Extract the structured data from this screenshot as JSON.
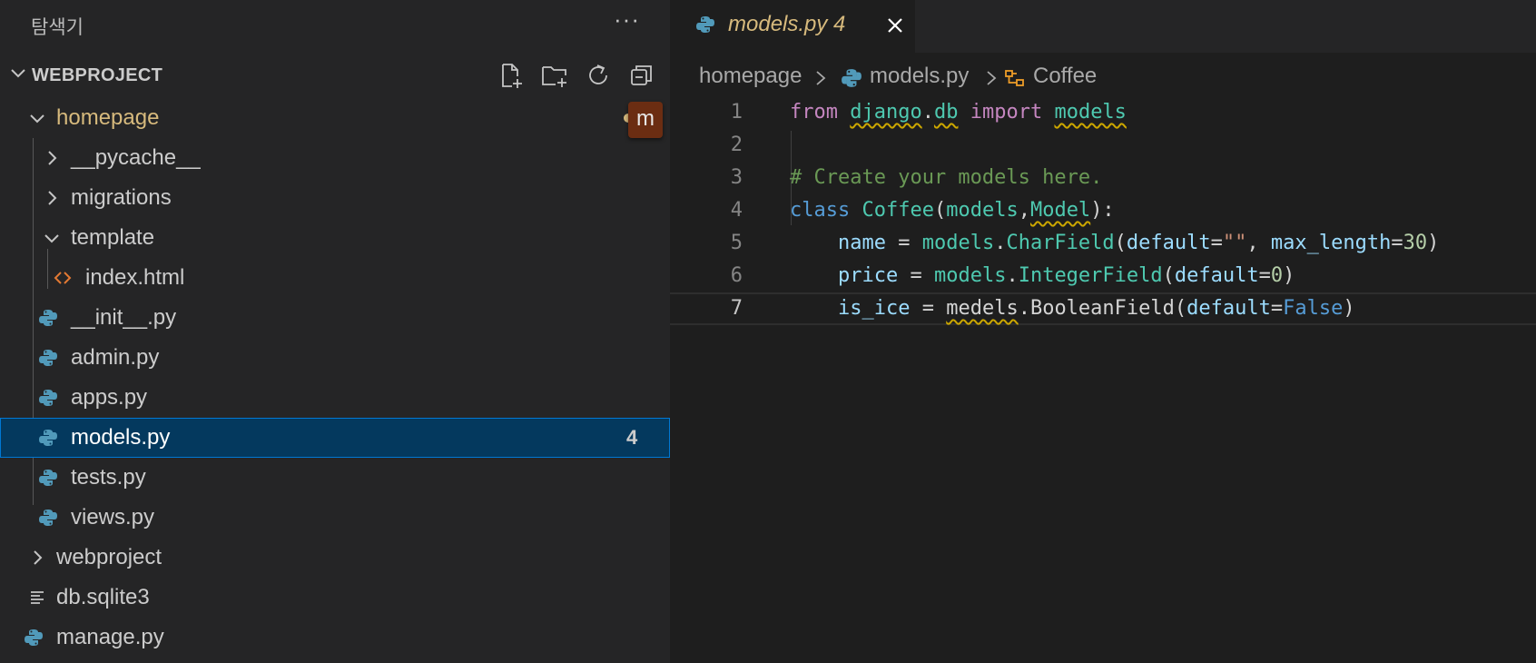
{
  "sidebar": {
    "title": "탐색기",
    "more": "···",
    "section_label": "WEBPROJECT",
    "actions": [
      "new-file-icon",
      "new-folder-icon",
      "refresh-icon",
      "collapse-all-icon"
    ],
    "tree": [
      {
        "label": "homepage",
        "type": "folder",
        "open": true,
        "modified": true,
        "badge": "m"
      },
      {
        "label": "__pycache__",
        "type": "folder",
        "open": false
      },
      {
        "label": "migrations",
        "type": "folder",
        "open": false
      },
      {
        "label": "template",
        "type": "folder",
        "open": true
      },
      {
        "label": "index.html",
        "type": "html"
      },
      {
        "label": "__init__.py",
        "type": "python"
      },
      {
        "label": "admin.py",
        "type": "python"
      },
      {
        "label": "apps.py",
        "type": "python"
      },
      {
        "label": "models.py",
        "type": "python",
        "selected": true,
        "count": "4"
      },
      {
        "label": "tests.py",
        "type": "python"
      },
      {
        "label": "views.py",
        "type": "python"
      },
      {
        "label": "webproject",
        "type": "folder",
        "open": false
      },
      {
        "label": "db.sqlite3",
        "type": "text"
      },
      {
        "label": "manage.py",
        "type": "python"
      }
    ]
  },
  "editor": {
    "tab": {
      "label": "models.py 4",
      "modified_color": "#d7ba7d"
    },
    "breadcrumb": {
      "folder": "homepage",
      "file": "models.py",
      "symbol": "Coffee"
    },
    "lines": [
      {
        "n": "1"
      },
      {
        "n": "2"
      },
      {
        "n": "3"
      },
      {
        "n": "4"
      },
      {
        "n": "5"
      },
      {
        "n": "6"
      },
      {
        "n": "7"
      }
    ],
    "current_line": "7"
  },
  "colors": {
    "accent": "#0078d4",
    "selection": "#04395e",
    "warning": "#cca700"
  }
}
